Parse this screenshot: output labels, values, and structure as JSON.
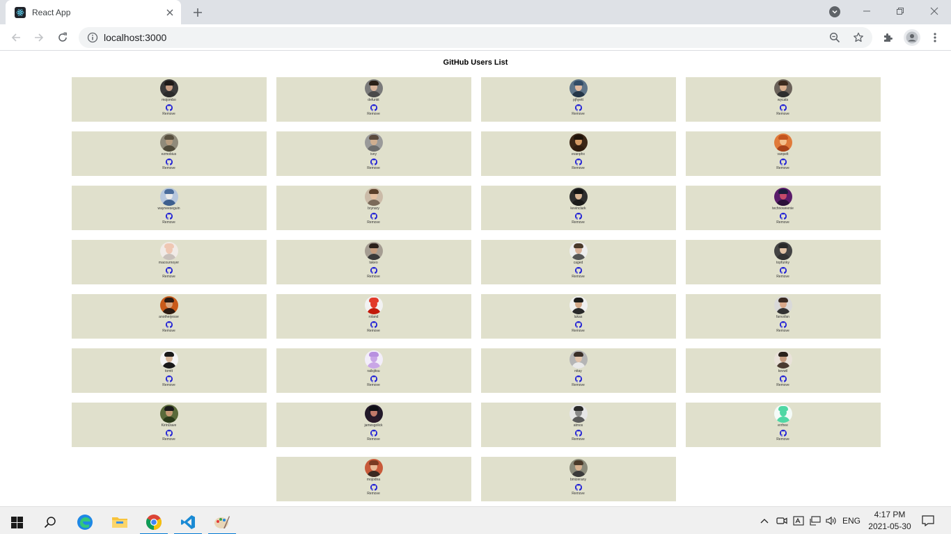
{
  "browser": {
    "tab_title": "React App",
    "url": "localhost:3000"
  },
  "page": {
    "title": "GitHub Users List",
    "remove_label": "Remove",
    "users": [
      {
        "login": "mojombo",
        "bg": "#3a3a3a",
        "skin": "#c69c83",
        "hair": "#1e1a18",
        "shirt": "#2b2b2b"
      },
      {
        "login": "defunkt",
        "bg": "#7a7a7a",
        "skin": "#d7b29a",
        "hair": "#2a1f18",
        "shirt": "#4a4a4a"
      },
      {
        "login": "pjhyett",
        "bg": "#5e7488",
        "skin": "#e0b9a0",
        "hair": "#324c66",
        "shirt": "#243648"
      },
      {
        "login": "wycats",
        "bg": "#6b625a",
        "skin": "#d8ad8d",
        "hair": "#3c2a1e",
        "shirt": "#2e2e2e"
      },
      {
        "login": "ezmobius",
        "bg": "#8f8a7a",
        "skin": "#b69c7f",
        "hair": "#58503f",
        "shirt": "#4f4a3a"
      },
      {
        "login": "ivey",
        "bg": "#9a9a9a",
        "skin": "#cfae90",
        "hair": "#5a4a3e",
        "shirt": "#6d6d6d"
      },
      {
        "login": "evanphx",
        "bg": "#3b2616",
        "skin": "#d49a64",
        "hair": "#1e130a",
        "shirt": "#2f1c0f"
      },
      {
        "login": "vanpelt",
        "bg": "#e07a3a",
        "skin": "#f4c08c",
        "hair": "#c4551f",
        "shirt": "#a8431a"
      },
      {
        "login": "wayneeseguin",
        "bg": "#b7c7dd",
        "skin": "#eaeaea",
        "hair": "#4a6c9b",
        "shirt": "#3d5f8e"
      },
      {
        "login": "brynary",
        "bg": "#cbbba8",
        "skin": "#e4bfa0",
        "hair": "#5a3f2a",
        "shirt": "#7a6a5a"
      },
      {
        "login": "kevinclark",
        "bg": "#2e2e2e",
        "skin": "#d9b595",
        "hair": "#141414",
        "shirt": "#1b1b1b"
      },
      {
        "login": "technoweenie",
        "bg": "#5a1c6a",
        "skin": "#c44a6a",
        "hair": "#1c1c3c",
        "shirt": "#2a0f3a"
      },
      {
        "login": "macournoyer",
        "bg": "#f1ebe7",
        "skin": "#efc7b3",
        "hair": "#efc7b3",
        "shirt": "#c8c0bb"
      },
      {
        "login": "takeo",
        "bg": "#a59d92",
        "skin": "#c59c7e",
        "hair": "#2b211b",
        "shirt": "#3a3a3a"
      },
      {
        "login": "caged",
        "bg": "#eeeeee",
        "skin": "#d8b098",
        "hair": "#4a3a2a",
        "shirt": "#555555"
      },
      {
        "login": "topfunky",
        "bg": "#444444",
        "skin": "#e2c3a6",
        "hair": "#2a2a2a",
        "shirt": "#333333"
      },
      {
        "login": "anotherjesse",
        "bg": "#c85a1a",
        "skin": "#d9a47c",
        "hair": "#2a1a12",
        "shirt": "#2a1a12"
      },
      {
        "login": "roland",
        "bg": "#f2f2f2",
        "skin": "#e23a2a",
        "hair": "#e23a2a",
        "shirt": "#c21a0a"
      },
      {
        "login": "lukas",
        "bg": "#f0f0f0",
        "skin": "#d3a98a",
        "hair": "#1a1a1a",
        "shirt": "#2a2a2a"
      },
      {
        "login": "fanvsfan",
        "bg": "#d9d9d9",
        "skin": "#d8a88a",
        "hair": "#3a2a22",
        "shirt": "#333333"
      },
      {
        "login": "tomtt",
        "bg": "#f5f5f5",
        "skin": "#d8b89c",
        "hair": "#1a1a1a",
        "shirt": "#1a1a1a"
      },
      {
        "login": "railsjitsu",
        "bg": "#f3eefa",
        "skin": "#c9a6e6",
        "hair": "#b890e0",
        "shirt": "#c9a6e6"
      },
      {
        "login": "nitay",
        "bg": "#b5b5b5",
        "skin": "#e2c4ac",
        "hair": "#3a2f28",
        "shirt": "#eaeaea"
      },
      {
        "login": "kevwil",
        "bg": "#e9e2d9",
        "skin": "#c59b80",
        "hair": "#2a211b",
        "shirt": "#4a3a30"
      },
      {
        "login": "KirinDave",
        "bg": "#5a6a3a",
        "skin": "#c69a74",
        "hair": "#1a1a1a",
        "shirt": "#2a3a1a"
      },
      {
        "login": "jamesgolick",
        "bg": "#231a2a",
        "skin": "#c27a6a",
        "hair": "#0f0f14",
        "shirt": "#2a1a2a"
      },
      {
        "login": "atmos",
        "bg": "#e6e6e6",
        "skin": "#8a8a8a",
        "hair": "#2a2a2a",
        "shirt": "#5a5a5a"
      },
      {
        "login": "errfree",
        "bg": "#f4fbf8",
        "skin": "#4fd7a4",
        "hair": "#4fd7a4",
        "shirt": "#4fd7a4"
      },
      {
        "login": "mojodna",
        "bg": "#c85a3a",
        "skin": "#e8b894",
        "hair": "#7a3a22",
        "shirt": "#3a2a22"
      },
      {
        "login": "bmizerany",
        "bg": "#8a8a7a",
        "skin": "#d7b190",
        "hair": "#4a3a2a",
        "shirt": "#3a3a3a"
      }
    ]
  },
  "taskbar": {
    "language": "ENG",
    "time": "4:17 PM",
    "date": "2021-05-30"
  }
}
